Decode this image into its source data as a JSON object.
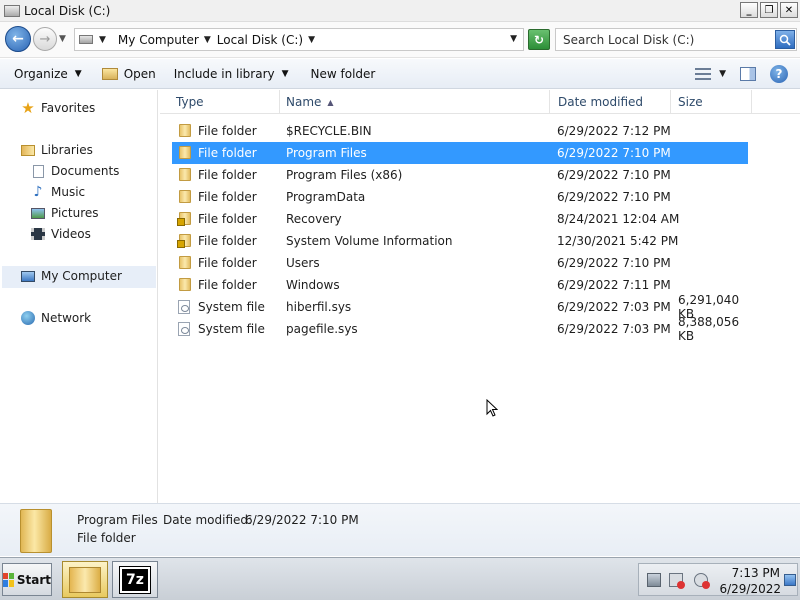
{
  "window": {
    "title": "Local Disk (C:)",
    "buttons": [
      "_",
      "❐",
      "✕"
    ]
  },
  "address": {
    "breadcrumbs": [
      "My Computer",
      "Local Disk (C:)"
    ]
  },
  "search": {
    "placeholder": "Search Local Disk (C:)"
  },
  "toolbar": {
    "organize": "Organize",
    "open": "Open",
    "include_in_library": "Include in library",
    "new_folder": "New folder"
  },
  "nav": {
    "favorites": "Favorites",
    "libraries": "Libraries",
    "documents": "Documents",
    "music": "Music",
    "pictures": "Pictures",
    "videos": "Videos",
    "my_computer": "My Computer",
    "network": "Network"
  },
  "columns": {
    "type": "Type",
    "name": "Name",
    "date": "Date modified",
    "size": "Size"
  },
  "files": [
    {
      "type": "File folder",
      "name": "$RECYCLE.BIN",
      "date": "6/29/2022 7:12 PM",
      "size": "",
      "icon": "folder-icon"
    },
    {
      "type": "File folder",
      "name": "Program Files",
      "date": "6/29/2022 7:10 PM",
      "size": "",
      "icon": "folder-icon",
      "selected": true
    },
    {
      "type": "File folder",
      "name": "Program Files (x86)",
      "date": "6/29/2022 7:10 PM",
      "size": "",
      "icon": "folder-icon"
    },
    {
      "type": "File folder",
      "name": "ProgramData",
      "date": "6/29/2022 7:10 PM",
      "size": "",
      "icon": "folder-icon"
    },
    {
      "type": "File folder",
      "name": "Recovery",
      "date": "8/24/2021 12:04 AM",
      "size": "",
      "icon": "locked-folder-icon"
    },
    {
      "type": "File folder",
      "name": "System Volume Information",
      "date": "12/30/2021 5:42 PM",
      "size": "",
      "icon": "locked-folder-icon"
    },
    {
      "type": "File folder",
      "name": "Users",
      "date": "6/29/2022 7:10 PM",
      "size": "",
      "icon": "folder-icon"
    },
    {
      "type": "File folder",
      "name": "Windows",
      "date": "6/29/2022 7:11 PM",
      "size": "",
      "icon": "folder-icon"
    },
    {
      "type": "System file",
      "name": "hiberfil.sys",
      "date": "6/29/2022 7:03 PM",
      "size": "6,291,040 KB",
      "icon": "system-file-icon"
    },
    {
      "type": "System file",
      "name": "pagefile.sys",
      "date": "6/29/2022 7:03 PM",
      "size": "8,388,056 KB",
      "icon": "system-file-icon"
    }
  ],
  "details": {
    "name": "Program Files",
    "modified_label": "Date modified:",
    "modified": "6/29/2022 7:10 PM",
    "type": "File folder"
  },
  "taskbar": {
    "start": "Start",
    "sevenzip": "7z",
    "time": "7:13 PM",
    "date": "6/29/2022"
  },
  "colors": {
    "selection": "#3399ff",
    "nav_selected": "#e7eef8"
  }
}
